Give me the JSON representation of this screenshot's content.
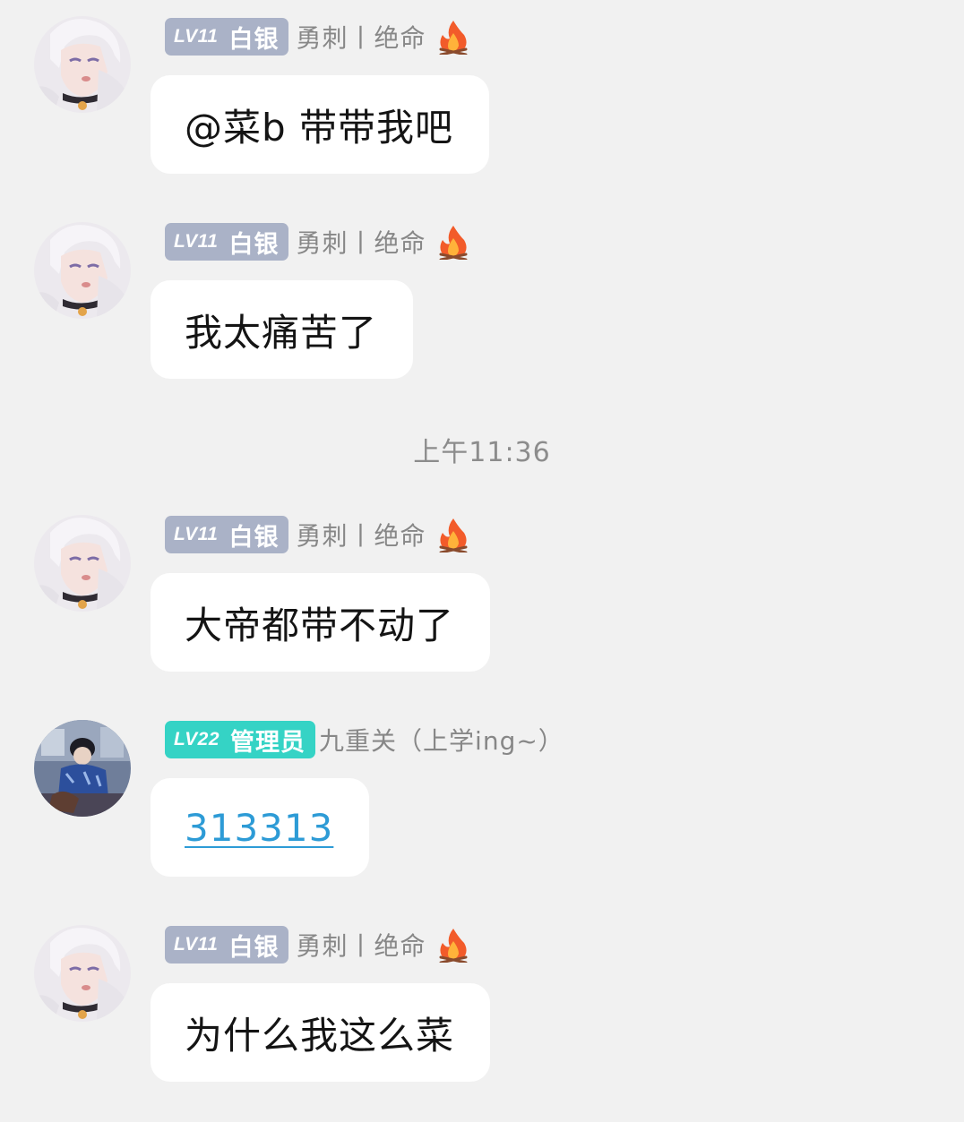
{
  "colors": {
    "background": "#f1f1f1",
    "bubble": "#ffffff",
    "badge_silver": "#aab2c7",
    "badge_admin": "#35d3c5",
    "nickname_gray": "#878787",
    "link_blue": "#2d9bd6"
  },
  "timestamp": "上午11:36",
  "messages": [
    {
      "avatar_icon": "anime-girl-avatar",
      "level": "LV11",
      "rank": "白银",
      "nickname": "勇刺丨绝命",
      "flair_icon": "fire-icon",
      "text": "@菜b 带带我吧"
    },
    {
      "avatar_icon": "anime-girl-avatar",
      "level": "LV11",
      "rank": "白银",
      "nickname": "勇刺丨绝命",
      "flair_icon": "fire-icon",
      "text": "我太痛苦了"
    },
    {
      "avatar_icon": "anime-girl-avatar",
      "level": "LV11",
      "rank": "白银",
      "nickname": "勇刺丨绝命",
      "flair_icon": "fire-icon",
      "text": "大帝都带不动了"
    },
    {
      "avatar_icon": "anime-boy-avatar",
      "level": "LV22",
      "rank": "管理员",
      "nickname": "九重关（上学ing~）",
      "text": "313313"
    },
    {
      "avatar_icon": "anime-girl-avatar",
      "level": "LV11",
      "rank": "白银",
      "nickname": "勇刺丨绝命",
      "flair_icon": "fire-icon",
      "text": "为什么我这么菜"
    }
  ]
}
